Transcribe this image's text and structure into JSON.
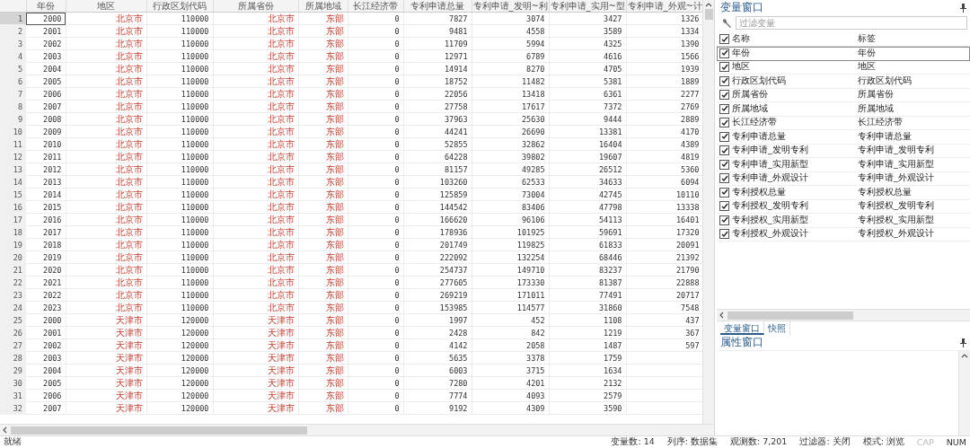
{
  "grid": {
    "columns": [
      {
        "label": "年份",
        "kind": "number"
      },
      {
        "label": "地区",
        "kind": "string"
      },
      {
        "label": "行政区划代码",
        "kind": "number"
      },
      {
        "label": "所属省份",
        "kind": "string"
      },
      {
        "label": "所属地域",
        "kind": "string"
      },
      {
        "label": "长江经济带",
        "kind": "number"
      },
      {
        "label": "专利申请总量",
        "kind": "number"
      },
      {
        "label": "专利申请_发明~利",
        "kind": "number"
      },
      {
        "label": "专利申请_实用~型",
        "kind": "number"
      },
      {
        "label": "专利申请_外观~计",
        "kind": "number"
      }
    ],
    "rows": [
      {
        "number": "1",
        "selected": true,
        "cells": [
          "2000",
          "北京市",
          "110000",
          "北京市",
          "东部",
          "0",
          "7827",
          "3074",
          "3427",
          "1326"
        ]
      },
      {
        "number": "2",
        "selected": false,
        "cells": [
          "2001",
          "北京市",
          "110000",
          "北京市",
          "东部",
          "0",
          "9481",
          "4558",
          "3589",
          "1334"
        ]
      },
      {
        "number": "3",
        "selected": false,
        "cells": [
          "2002",
          "北京市",
          "110000",
          "北京市",
          "东部",
          "0",
          "11709",
          "5994",
          "4325",
          "1390"
        ]
      },
      {
        "number": "4",
        "selected": false,
        "cells": [
          "2003",
          "北京市",
          "110000",
          "北京市",
          "东部",
          "0",
          "12971",
          "6789",
          "4616",
          "1566"
        ]
      },
      {
        "number": "5",
        "selected": false,
        "cells": [
          "2004",
          "北京市",
          "110000",
          "北京市",
          "东部",
          "0",
          "14914",
          "8270",
          "4705",
          "1939"
        ]
      },
      {
        "number": "6",
        "selected": false,
        "cells": [
          "2005",
          "北京市",
          "110000",
          "北京市",
          "东部",
          "0",
          "18752",
          "11482",
          "5381",
          "1889"
        ]
      },
      {
        "number": "7",
        "selected": false,
        "cells": [
          "2006",
          "北京市",
          "110000",
          "北京市",
          "东部",
          "0",
          "22056",
          "13418",
          "6361",
          "2277"
        ]
      },
      {
        "number": "8",
        "selected": false,
        "cells": [
          "2007",
          "北京市",
          "110000",
          "北京市",
          "东部",
          "0",
          "27758",
          "17617",
          "7372",
          "2769"
        ]
      },
      {
        "number": "9",
        "selected": false,
        "cells": [
          "2008",
          "北京市",
          "110000",
          "北京市",
          "东部",
          "0",
          "37963",
          "25630",
          "9444",
          "2889"
        ]
      },
      {
        "number": "10",
        "selected": false,
        "cells": [
          "2009",
          "北京市",
          "110000",
          "北京市",
          "东部",
          "0",
          "44241",
          "26690",
          "13381",
          "4170"
        ]
      },
      {
        "number": "11",
        "selected": false,
        "cells": [
          "2010",
          "北京市",
          "110000",
          "北京市",
          "东部",
          "0",
          "52855",
          "32862",
          "16404",
          "4389"
        ]
      },
      {
        "number": "12",
        "selected": false,
        "cells": [
          "2011",
          "北京市",
          "110000",
          "北京市",
          "东部",
          "0",
          "64228",
          "39802",
          "19607",
          "4819"
        ]
      },
      {
        "number": "13",
        "selected": false,
        "cells": [
          "2012",
          "北京市",
          "110000",
          "北京市",
          "东部",
          "0",
          "81157",
          "49285",
          "26512",
          "5360"
        ]
      },
      {
        "number": "14",
        "selected": false,
        "cells": [
          "2013",
          "北京市",
          "110000",
          "北京市",
          "东部",
          "0",
          "103260",
          "62533",
          "34633",
          "6094"
        ]
      },
      {
        "number": "15",
        "selected": false,
        "cells": [
          "2014",
          "北京市",
          "110000",
          "北京市",
          "东部",
          "0",
          "125859",
          "73004",
          "42745",
          "10110"
        ]
      },
      {
        "number": "16",
        "selected": false,
        "cells": [
          "2015",
          "北京市",
          "110000",
          "北京市",
          "东部",
          "0",
          "144542",
          "83406",
          "47798",
          "13338"
        ]
      },
      {
        "number": "17",
        "selected": false,
        "cells": [
          "2016",
          "北京市",
          "110000",
          "北京市",
          "东部",
          "0",
          "166620",
          "96106",
          "54113",
          "16401"
        ]
      },
      {
        "number": "18",
        "selected": false,
        "cells": [
          "2017",
          "北京市",
          "110000",
          "北京市",
          "东部",
          "0",
          "178936",
          "101925",
          "59691",
          "17320"
        ]
      },
      {
        "number": "19",
        "selected": false,
        "cells": [
          "2018",
          "北京市",
          "110000",
          "北京市",
          "东部",
          "0",
          "201749",
          "119825",
          "61833",
          "20091"
        ]
      },
      {
        "number": "20",
        "selected": false,
        "cells": [
          "2019",
          "北京市",
          "110000",
          "北京市",
          "东部",
          "0",
          "222092",
          "132254",
          "68446",
          "21392"
        ]
      },
      {
        "number": "21",
        "selected": false,
        "cells": [
          "2020",
          "北京市",
          "110000",
          "北京市",
          "东部",
          "0",
          "254737",
          "149710",
          "83237",
          "21790"
        ]
      },
      {
        "number": "22",
        "selected": false,
        "cells": [
          "2021",
          "北京市",
          "110000",
          "北京市",
          "东部",
          "0",
          "277605",
          "173330",
          "81387",
          "22888"
        ]
      },
      {
        "number": "23",
        "selected": false,
        "cells": [
          "2022",
          "北京市",
          "110000",
          "北京市",
          "东部",
          "0",
          "269219",
          "171011",
          "77491",
          "20717"
        ]
      },
      {
        "number": "24",
        "selected": false,
        "cells": [
          "2023",
          "北京市",
          "110000",
          "北京市",
          "东部",
          "0",
          "153985",
          "114577",
          "31860",
          "7548"
        ]
      },
      {
        "number": "25",
        "selected": false,
        "cells": [
          "2000",
          "天津市",
          "120000",
          "天津市",
          "东部",
          "0",
          "1997",
          "452",
          "1108",
          "437"
        ]
      },
      {
        "number": "26",
        "selected": false,
        "cells": [
          "2001",
          "天津市",
          "120000",
          "天津市",
          "东部",
          "0",
          "2428",
          "842",
          "1219",
          "367"
        ]
      },
      {
        "number": "27",
        "selected": false,
        "cells": [
          "2002",
          "天津市",
          "120000",
          "天津市",
          "东部",
          "0",
          "4142",
          "2058",
          "1487",
          "597"
        ]
      },
      {
        "number": "28",
        "selected": false,
        "cells": [
          "2003",
          "天津市",
          "120000",
          "天津市",
          "东部",
          "0",
          "5635",
          "3378",
          "1759"
        ]
      },
      {
        "number": "29",
        "selected": false,
        "cells": [
          "2004",
          "天津市",
          "120000",
          "天津市",
          "东部",
          "0",
          "6003",
          "3715",
          "1634"
        ]
      },
      {
        "number": "30",
        "selected": false,
        "cells": [
          "2005",
          "天津市",
          "120000",
          "天津市",
          "东部",
          "0",
          "7280",
          "4201",
          "2132"
        ]
      },
      {
        "number": "31",
        "selected": false,
        "cells": [
          "2006",
          "天津市",
          "120000",
          "天津市",
          "东部",
          "0",
          "7774",
          "4093",
          "2579"
        ]
      },
      {
        "number": "32",
        "selected": false,
        "cells": [
          "2007",
          "天津市",
          "120000",
          "天津市",
          "东部",
          "0",
          "9192",
          "4309",
          "3590"
        ]
      }
    ]
  },
  "variables_window": {
    "title": "变量窗口",
    "filter": {
      "placeholder": "过滤变量"
    },
    "all_checked": true,
    "columns": [
      "名称",
      "标签"
    ],
    "variables": [
      {
        "name": "年份",
        "label": "年份",
        "checked": true,
        "selected": true
      },
      {
        "name": "地区",
        "label": "地区",
        "checked": true,
        "selected": false
      },
      {
        "name": "行政区划代码",
        "label": "行政区划代码",
        "checked": true,
        "selected": false
      },
      {
        "name": "所属省份",
        "label": "所属省份",
        "checked": true,
        "selected": false
      },
      {
        "name": "所属地域",
        "label": "所属地域",
        "checked": true,
        "selected": false
      },
      {
        "name": "长江经济带",
        "label": "长江经济带",
        "checked": true,
        "selected": false
      },
      {
        "name": "专利申请总量",
        "label": "专利申请总量",
        "checked": true,
        "selected": false
      },
      {
        "name": "专利申请_发明专利",
        "label": "专利申请_发明专利",
        "checked": true,
        "selected": false
      },
      {
        "name": "专利申请_实用新型",
        "label": "专利申请_实用新型",
        "checked": true,
        "selected": false
      },
      {
        "name": "专利申请_外观设计",
        "label": "专利申请_外观设计",
        "checked": true,
        "selected": false
      },
      {
        "name": "专利授权总量",
        "label": "专利授权总量",
        "checked": true,
        "selected": false
      },
      {
        "name": "专利授权_发明专利",
        "label": "专利授权_发明专利",
        "checked": true,
        "selected": false
      },
      {
        "name": "专利授权_实用新型",
        "label": "专利授权_实用新型",
        "checked": true,
        "selected": false
      },
      {
        "name": "专利授权_外观设计",
        "label": "专利授权_外观设计",
        "checked": true,
        "selected": false
      }
    ]
  },
  "panel_tabs": [
    {
      "label": "变量窗口",
      "selected": true
    },
    {
      "label": "快照",
      "selected": false
    }
  ],
  "properties_window": {
    "title": "属性窗口"
  },
  "status_bar": {
    "message": "就绪",
    "items": [
      {
        "text": "变量数: 14",
        "disabled": false
      },
      {
        "text": "列序: 数据集",
        "disabled": false
      },
      {
        "text": "观测数: 7,201",
        "disabled": false
      },
      {
        "text": "过滤器: 关闭",
        "disabled": false
      },
      {
        "text": "模式: 浏览",
        "disabled": false
      },
      {
        "text": "CAP",
        "disabled": true
      },
      {
        "text": "NUM",
        "disabled": false
      }
    ]
  }
}
